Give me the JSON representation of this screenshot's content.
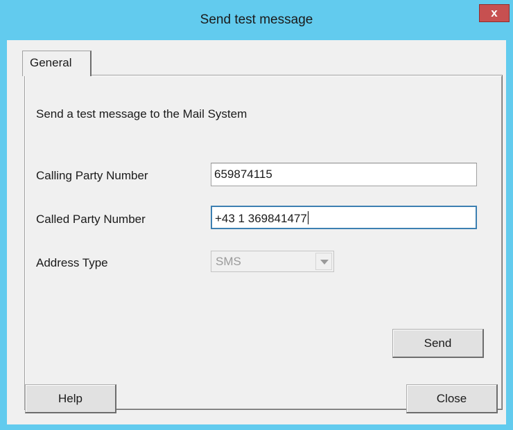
{
  "window": {
    "title": "Send test message",
    "close_glyph": "x"
  },
  "tabs": [
    {
      "label": "General",
      "selected": true
    }
  ],
  "general": {
    "description": "Send a test message to the Mail System",
    "calling_party": {
      "label": "Calling Party Number",
      "value": "659874115"
    },
    "called_party": {
      "label": "Called Party Number",
      "value": "+43 1 369841477"
    },
    "address_type": {
      "label": "Address Type",
      "value": "SMS",
      "enabled": false
    },
    "send_label": "Send"
  },
  "footer": {
    "help_label": "Help",
    "close_label": "Close"
  },
  "colors": {
    "title_bar": "#62cbee",
    "close_button": "#c75050",
    "dialog_face": "#f0f0f0"
  },
  "icons": {
    "close": "close-icon",
    "dropdown": "chevron-down-icon"
  }
}
